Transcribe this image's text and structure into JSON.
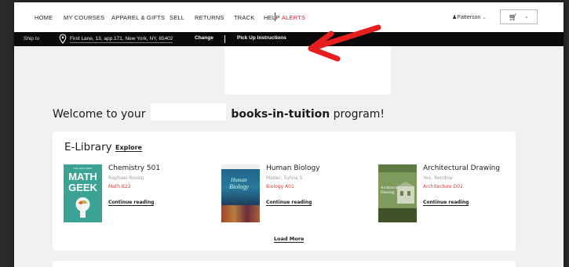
{
  "nav": {
    "items": [
      {
        "label": "HOME",
        "x": 0
      },
      {
        "label": "MY COURSES"
      },
      {
        "label": "APPAREL & GIFTS"
      },
      {
        "label": "SELL"
      },
      {
        "label": "RETURNS"
      },
      {
        "label": "TRACK"
      },
      {
        "label": "HELP"
      }
    ],
    "alerts": "ALERTS",
    "user": "Patterson"
  },
  "ship": {
    "label": "Ship to",
    "address": "First Lane, 13, app.171, New York, NY, 65402",
    "change": "Change",
    "pickup": "Pick Up Instructions"
  },
  "welcome": {
    "prefix": "Welcome to your",
    "bold": "books-in-tuition",
    "suffix": "program!"
  },
  "elibrary": {
    "title": "E-Library",
    "explore": "Explore",
    "load_more": "Load More",
    "continue_label": "Continue reading",
    "books": [
      {
        "title": "Chemistry 501",
        "author": "Raphael Rossin",
        "course": "Math B22",
        "cover_text": [
          "MATH",
          "GEEK"
        ]
      },
      {
        "title": "Human Biology",
        "author": "Mader, Sylvia S",
        "course": "Biology A01",
        "cover_text": [
          "Human",
          "Biology"
        ]
      },
      {
        "title": "Architectural Drawing",
        "author": "Yee, Rendow",
        "course": "Architecture D02",
        "cover_text": [
          "Architectural",
          "Drawing"
        ]
      }
    ]
  },
  "colors": {
    "alert": "#d01f2a",
    "course": "#d23a3a",
    "shipbar": "#0a0a0a",
    "arrow": "#e61e1e"
  }
}
